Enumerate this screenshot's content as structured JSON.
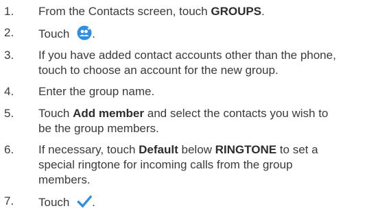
{
  "steps": [
    {
      "num": "1.",
      "pre": "From the Contacts screen, touch ",
      "bold": "GROUPS",
      "post": "."
    },
    {
      "num": "2.",
      "pre": "Touch ",
      "icon": "add-group-icon",
      "post": "."
    },
    {
      "num": "3.",
      "line1": "If you have added contact accounts other than the phone,",
      "line2": "touch to choose an account for the new group."
    },
    {
      "num": "4.",
      "text": "Enter the group name."
    },
    {
      "num": "5.",
      "pre": "Touch ",
      "bold": "Add member",
      "post": " and select the contacts you wish to",
      "line2": "be the group members."
    },
    {
      "num": "6.",
      "pre": "If necessary, touch ",
      "bold": "Default",
      "mid": " below ",
      "bold2": "RINGTONE",
      "post": " to set a",
      "line2": "special ringtone for incoming calls from the group",
      "line3": "members."
    },
    {
      "num": "7.",
      "pre": "Touch ",
      "icon": "check-icon",
      "post": "."
    }
  ],
  "colors": {
    "icon_blue": "#2f8fe0",
    "text": "#3a3a3a"
  }
}
